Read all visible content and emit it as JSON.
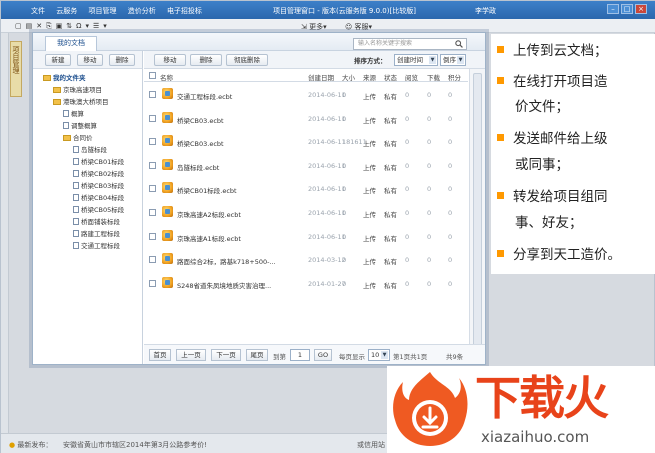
{
  "app": {
    "menu": [
      "文件",
      "云服务",
      "项目管理",
      "造价分析",
      "电子招投标"
    ],
    "title": "项目管理窗口 - 版本(云服务版 9.0.0)[比较版]",
    "user": "李学政",
    "toolbar_more": "更多",
    "toolbar_service": "客服",
    "side_tab": "项目管理",
    "status_prefix": "最新发布：",
    "status_news": "安徽省黄山市市辖区2014年第3月公路参考价!",
    "status_right": "或信用站"
  },
  "dialog": {
    "tab": "我的文档",
    "search_placeholder": "输入名称关键字搜索",
    "left_buttons": [
      "新建",
      "移动",
      "删除"
    ],
    "right_buttons": [
      "移动",
      "删除",
      "彻底删除"
    ],
    "sort_label": "排序方式：",
    "sort_field": "创建时间",
    "sort_order": "倒序",
    "tree": {
      "root": "我的文件夹",
      "folders": [
        "京珠高速项目",
        "港珠澳大桥项目"
      ],
      "items": [
        "概算",
        "调整概算",
        "合同价"
      ],
      "contracts": [
        "岛隧标段",
        "桥梁CB01标段",
        "桥梁CB02标段",
        "桥梁CB03标段",
        "桥梁CB04标段",
        "桥梁CB05标段",
        "桥面铺装标段",
        "路建工程标段",
        "交通工程标段"
      ]
    },
    "columns": [
      "名称",
      "创建日期",
      "大小",
      "来源",
      "状态",
      "阅览",
      "下载",
      "积分"
    ],
    "rows": [
      {
        "name": "交通工程标段.ecbt",
        "date": "2014-06-11",
        "size": "0",
        "source": "上传",
        "status": "私有",
        "view": "0",
        "down": "0",
        "score": "0"
      },
      {
        "name": "桥梁CB03.ecbt",
        "date": "2014-06-11",
        "size": "0",
        "source": "上传",
        "status": "私有",
        "view": "0",
        "down": "0",
        "score": "0"
      },
      {
        "name": "桥梁CB03.ecbt",
        "date": "2014-06-11",
        "size": "181611",
        "source": "上传",
        "status": "私有",
        "view": "0",
        "down": "0",
        "score": "0"
      },
      {
        "name": "岛隧标段.ecbt",
        "date": "2014-06-11",
        "size": "0",
        "source": "上传",
        "status": "私有",
        "view": "0",
        "down": "0",
        "score": "0"
      },
      {
        "name": "桥梁CB01标段.ecbt",
        "date": "2014-06-11",
        "size": "0",
        "source": "上传",
        "status": "私有",
        "view": "0",
        "down": "0",
        "score": "0"
      },
      {
        "name": "京珠高速A2标段.ecbt",
        "date": "2014-06-11",
        "size": "0",
        "source": "上传",
        "status": "私有",
        "view": "0",
        "down": "0",
        "score": "0"
      },
      {
        "name": "京珠高速A1标段.ecbt",
        "date": "2014-06-11",
        "size": "0",
        "source": "上传",
        "status": "私有",
        "view": "0",
        "down": "0",
        "score": "0"
      },
      {
        "name": "路面综合2标，路基k718+500-...",
        "date": "2014-03-12",
        "size": "0",
        "source": "上传",
        "status": "私有",
        "view": "0",
        "down": "0",
        "score": "0"
      },
      {
        "name": "S248省道朱凤境地质灾害治理...",
        "date": "2014-01-27",
        "size": "0",
        "source": "上传",
        "status": "私有",
        "view": "0",
        "down": "0",
        "score": "0"
      }
    ],
    "pager": {
      "first": "首页",
      "prev": "上一页",
      "next": "下一页",
      "last": "尾页",
      "goto_label": "到第",
      "page_input": "1",
      "go": "GO",
      "per_page_label": "每页显示",
      "per_page": "10",
      "status": "第1页共1页",
      "total": "共9条"
    }
  },
  "features": [
    "上传到云文档；",
    "在线打开项目造",
    "价文件；",
    "发送邮件给上级",
    "或同事；",
    "转发给项目组同",
    "事、好友；",
    "分享到天工造价。"
  ],
  "logo": {
    "text": "下载火",
    "url": "xiazaihuo.com"
  },
  "colors": {
    "accent": "#ff9900",
    "brand": "#e8431a",
    "titlebar": "#2b67ad"
  }
}
